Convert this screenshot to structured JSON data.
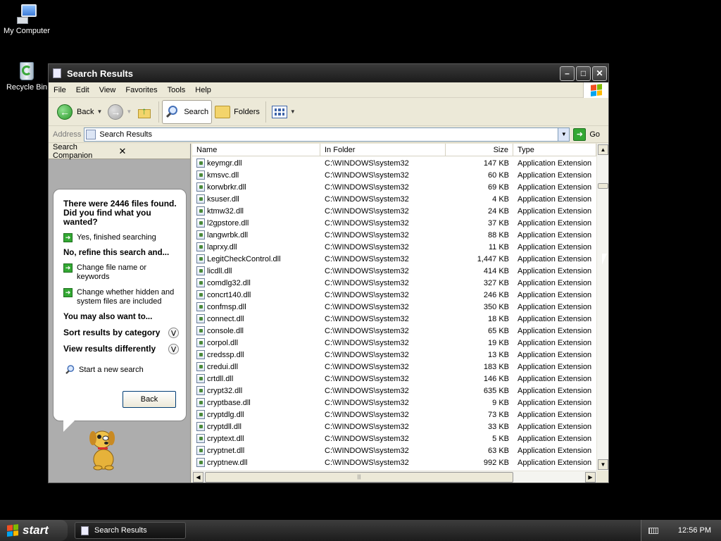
{
  "desktop": {
    "icons": [
      {
        "label": "My Computer"
      },
      {
        "label": "Recycle Bin"
      }
    ]
  },
  "window": {
    "title": "Search Results",
    "buttons": {
      "minimize": "–",
      "maximize": "□",
      "close": "✕"
    }
  },
  "menubar": {
    "items": [
      "File",
      "Edit",
      "View",
      "Favorites",
      "Tools",
      "Help"
    ]
  },
  "toolbar": {
    "back_label": "Back",
    "search_label": "Search",
    "folders_label": "Folders"
  },
  "addressbar": {
    "label": "Address",
    "value": "Search Results",
    "go_label": "Go"
  },
  "companion": {
    "header": "Search Companion",
    "heading": "There were 2446 files found. Did you find what you wanted?",
    "yes_label": "Yes, finished searching",
    "refine_heading": "No, refine this search and...",
    "change_name": "Change file name or keywords",
    "change_hidden": "Change whether hidden and system files are included",
    "also_heading": "You may also want to...",
    "sort_label": "Sort results by category",
    "view_label": "View results differently",
    "new_search": "Start a new search",
    "back_button": "Back"
  },
  "list": {
    "columns": {
      "name": "Name",
      "folder": "In Folder",
      "size": "Size",
      "type": "Type"
    },
    "rows": [
      {
        "name": "keymgr.dll",
        "folder": "C:\\WINDOWS\\system32",
        "size": "147 KB",
        "type": "Application Extension"
      },
      {
        "name": "kmsvc.dll",
        "folder": "C:\\WINDOWS\\system32",
        "size": "60 KB",
        "type": "Application Extension"
      },
      {
        "name": "korwbrkr.dll",
        "folder": "C:\\WINDOWS\\system32",
        "size": "69 KB",
        "type": "Application Extension"
      },
      {
        "name": "ksuser.dll",
        "folder": "C:\\WINDOWS\\system32",
        "size": "4 KB",
        "type": "Application Extension"
      },
      {
        "name": "ktmw32.dll",
        "folder": "C:\\WINDOWS\\system32",
        "size": "24 KB",
        "type": "Application Extension"
      },
      {
        "name": "l2gpstore.dll",
        "folder": "C:\\WINDOWS\\system32",
        "size": "37 KB",
        "type": "Application Extension"
      },
      {
        "name": "langwrbk.dll",
        "folder": "C:\\WINDOWS\\system32",
        "size": "88 KB",
        "type": "Application Extension"
      },
      {
        "name": "laprxy.dll",
        "folder": "C:\\WINDOWS\\system32",
        "size": "11 KB",
        "type": "Application Extension"
      },
      {
        "name": "LegitCheckControl.dll",
        "folder": "C:\\WINDOWS\\system32",
        "size": "1,447 KB",
        "type": "Application Extension"
      },
      {
        "name": "licdll.dll",
        "folder": "C:\\WINDOWS\\system32",
        "size": "414 KB",
        "type": "Application Extension"
      },
      {
        "name": "comdlg32.dll",
        "folder": "C:\\WINDOWS\\system32",
        "size": "327 KB",
        "type": "Application Extension"
      },
      {
        "name": "concrt140.dll",
        "folder": "C:\\WINDOWS\\system32",
        "size": "246 KB",
        "type": "Application Extension"
      },
      {
        "name": "confmsp.dll",
        "folder": "C:\\WINDOWS\\system32",
        "size": "350 KB",
        "type": "Application Extension"
      },
      {
        "name": "connect.dll",
        "folder": "C:\\WINDOWS\\system32",
        "size": "18 KB",
        "type": "Application Extension"
      },
      {
        "name": "console.dll",
        "folder": "C:\\WINDOWS\\system32",
        "size": "65 KB",
        "type": "Application Extension"
      },
      {
        "name": "corpol.dll",
        "folder": "C:\\WINDOWS\\system32",
        "size": "19 KB",
        "type": "Application Extension"
      },
      {
        "name": "credssp.dll",
        "folder": "C:\\WINDOWS\\system32",
        "size": "13 KB",
        "type": "Application Extension"
      },
      {
        "name": "credui.dll",
        "folder": "C:\\WINDOWS\\system32",
        "size": "183 KB",
        "type": "Application Extension"
      },
      {
        "name": "crtdll.dll",
        "folder": "C:\\WINDOWS\\system32",
        "size": "146 KB",
        "type": "Application Extension"
      },
      {
        "name": "crypt32.dll",
        "folder": "C:\\WINDOWS\\system32",
        "size": "635 KB",
        "type": "Application Extension"
      },
      {
        "name": "cryptbase.dll",
        "folder": "C:\\WINDOWS\\system32",
        "size": "9 KB",
        "type": "Application Extension"
      },
      {
        "name": "cryptdlg.dll",
        "folder": "C:\\WINDOWS\\system32",
        "size": "73 KB",
        "type": "Application Extension"
      },
      {
        "name": "cryptdll.dll",
        "folder": "C:\\WINDOWS\\system32",
        "size": "33 KB",
        "type": "Application Extension"
      },
      {
        "name": "cryptext.dll",
        "folder": "C:\\WINDOWS\\system32",
        "size": "5 KB",
        "type": "Application Extension"
      },
      {
        "name": "cryptnet.dll",
        "folder": "C:\\WINDOWS\\system32",
        "size": "63 KB",
        "type": "Application Extension"
      },
      {
        "name": "cryptnew.dll",
        "folder": "C:\\WINDOWS\\system32",
        "size": "992 KB",
        "type": "Application Extension"
      }
    ]
  },
  "taskbar": {
    "start_label": "start",
    "task_label": "Search Results",
    "clock": "12:56 PM"
  },
  "colors": {
    "xp_flag": [
      "#f25022",
      "#7fba00",
      "#00a4ef",
      "#ffb900"
    ]
  }
}
